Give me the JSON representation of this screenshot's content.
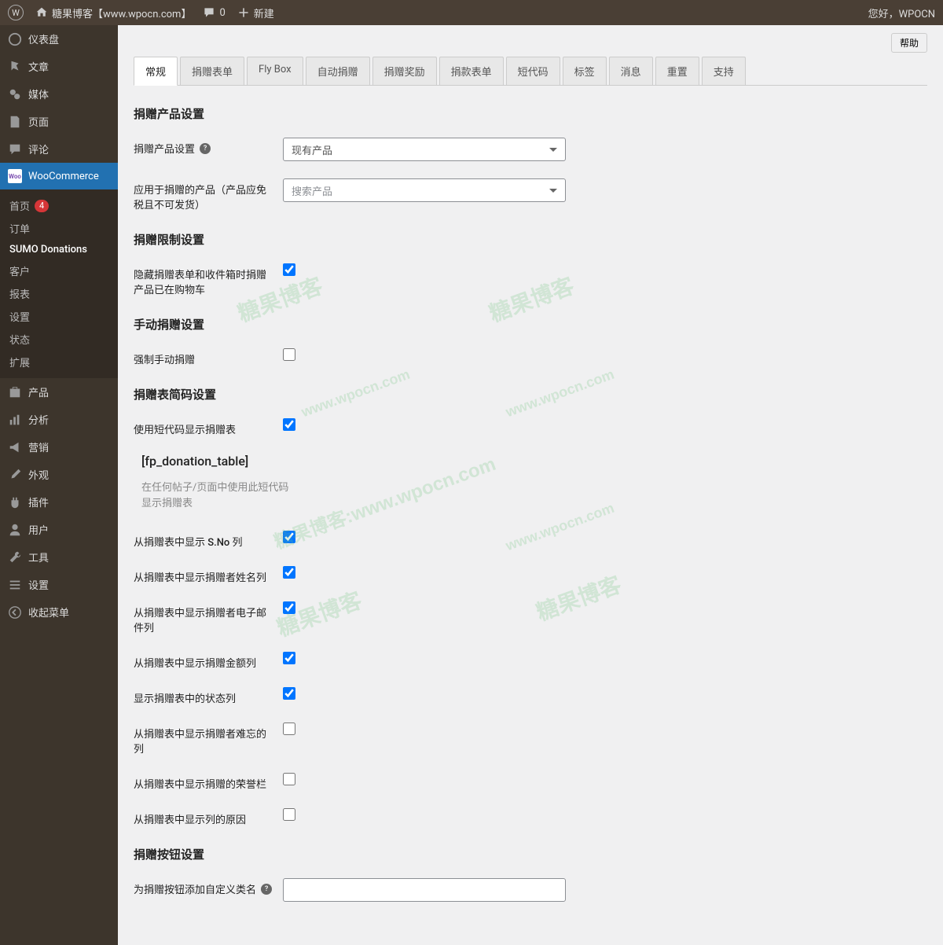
{
  "adminbar": {
    "site_name": "糖果博客【www.wpocn.com】",
    "comments_count": "0",
    "new_label": "新建",
    "greeting": "您好，WPOCN"
  },
  "sidebar": {
    "dashboard": "仪表盘",
    "posts": "文章",
    "media": "媒体",
    "pages": "页面",
    "comments": "评论",
    "woocommerce": "WooCommerce",
    "woo_sub": {
      "home": "首页",
      "home_badge": "4",
      "orders": "订单",
      "sumo": "SUMO Donations",
      "customers": "客户",
      "reports": "报表",
      "settings": "设置",
      "status": "状态",
      "extensions": "扩展"
    },
    "products": "产品",
    "analytics": "分析",
    "marketing": "营销",
    "appearance": "外观",
    "plugins": "插件",
    "users": "用户",
    "tools": "工具",
    "settings": "设置",
    "collapse": "收起菜单"
  },
  "help_button": "帮助",
  "tabs": [
    "常规",
    "捐赠表单",
    "Fly Box",
    "自动捐赠",
    "捐赠奖励",
    "捐款表单",
    "短代码",
    "标签",
    "消息",
    "重置",
    "支持"
  ],
  "sections": {
    "product_settings_heading": "捐赠产品设置",
    "product_settings_label": "捐赠产品设置",
    "product_settings_value": "现有产品",
    "product_for_donation_label": "应用于捐赠的产品（产品应免税且不可发货）",
    "product_search_placeholder": "搜索产品",
    "limit_heading": "捐赠限制设置",
    "hide_form_label": "隐藏捐赠表单和收件箱时捐赠产品已在购物车",
    "manual_heading": "手动捐赠设置",
    "force_manual_label": "强制手动捐赠",
    "shortcode_heading": "捐赠表简码设置",
    "use_shortcode_label": "使用短代码显示捐赠表",
    "shortcode_code": "[fp_donation_table]",
    "shortcode_desc": "在任何帖子/页面中使用此短代码显示捐赠表",
    "show_sno": "从捐赠表中显示 S.No 列",
    "show_name": "从捐赠表中显示捐赠者姓名列",
    "show_email": "从捐赠表中显示捐赠者电子邮件列",
    "show_amount": "从捐赠表中显示捐赠金额列",
    "show_status": "显示捐赠表中的状态列",
    "show_hard": "从捐赠表中显示捐赠者难忘的列",
    "show_honor": "从捐赠表中显示捐赠的荣誉栏",
    "show_reason": "从捐赠表中显示列的原因",
    "button_heading": "捐赠按钮设置",
    "button_class_label": "为捐赠按钮添加自定义类名"
  }
}
